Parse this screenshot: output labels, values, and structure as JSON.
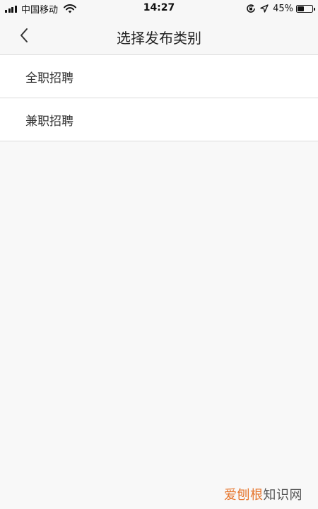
{
  "status_bar": {
    "carrier": "中国移动",
    "time": "14:27",
    "battery_percent": "45%",
    "battery_level": 0.45,
    "icons": [
      "signal-icon",
      "wifi-icon",
      "orientation-lock-icon",
      "location-icon",
      "battery-icon"
    ]
  },
  "nav": {
    "title": "选择发布类别",
    "back_icon": "chevron-left-icon"
  },
  "list": {
    "items": [
      {
        "label": "全职招聘"
      },
      {
        "label": "兼职招聘"
      }
    ]
  },
  "watermark": {
    "part1": "爱刨根",
    "part2": "知识网",
    "color_part1": "#e6762e",
    "color_part2": "#555555"
  }
}
